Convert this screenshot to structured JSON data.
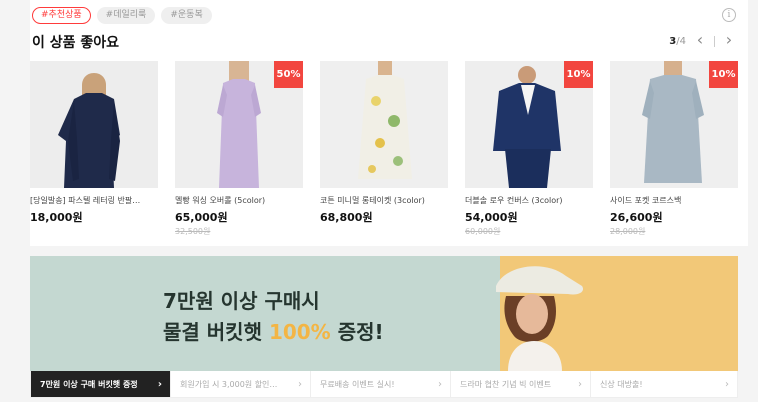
{
  "tags": [
    "#추천상품",
    "#데일리룩",
    "#운동복"
  ],
  "info_icon": "i",
  "section_title": "이 상품 좋아요",
  "pager": {
    "current": "3",
    "total": "/4",
    "prev": "‹",
    "next": "›"
  },
  "products": [
    {
      "name": "[당일발송] 파스텔 레터링 반팔…",
      "price": "18,000원",
      "original_price": "",
      "badge": ""
    },
    {
      "name": "멜빵 워싱 오버롤 (5color)",
      "price": "65,000원",
      "original_price": "32,500원",
      "badge": "50%"
    },
    {
      "name": "코튼 미니멀 롱테이켓 (3color)",
      "price": "68,800원",
      "original_price": "",
      "badge": ""
    },
    {
      "name": "더블솔 로우 컨버스 (3color)",
      "price": "54,000원",
      "original_price": "60,000원",
      "badge": "10%"
    },
    {
      "name": "사이드 포켓 코르스백",
      "price": "26,600원",
      "original_price": "28,000원",
      "badge": "10%"
    }
  ],
  "banner": {
    "line1": "7만원 이상 구매시",
    "line2_pre": "물결 버킷햇 ",
    "line2_highlight": "100%",
    "line2_post": " 증정!"
  },
  "banner_tabs": [
    {
      "label": "7만원 이상 구매 버킷햇 증정",
      "chevron": "›"
    },
    {
      "label": "회원가입 시 3,000원 할인…",
      "chevron": "›"
    },
    {
      "label": "무료배송 이벤트 실시!",
      "chevron": "›"
    },
    {
      "label": "드라마 협찬 기념 빅 이벤트",
      "chevron": "›"
    },
    {
      "label": "신상 대방출!",
      "chevron": "›"
    }
  ],
  "colors": {
    "accent": "#f2463f",
    "banner_green": "#c4d8d1",
    "banner_yellow": "#f2c878",
    "highlight": "#f3b544"
  }
}
